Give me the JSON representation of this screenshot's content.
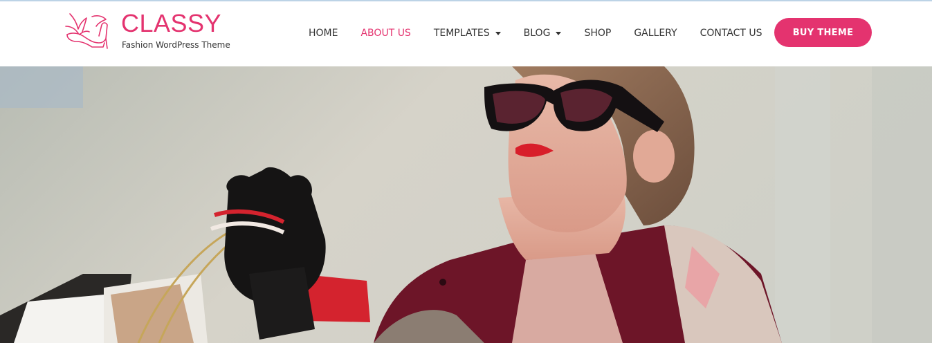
{
  "brand": {
    "title": "CLASSY",
    "tagline": "Fashion WordPress Theme",
    "accent_color": "#e4336f",
    "logo_icon": "high-heel-shoe-icon"
  },
  "nav": {
    "items": [
      {
        "label": "HOME",
        "active": false,
        "has_dropdown": false
      },
      {
        "label": "ABOUT US",
        "active": true,
        "has_dropdown": false
      },
      {
        "label": "TEMPLATES",
        "active": false,
        "has_dropdown": true
      },
      {
        "label": "BLOG",
        "active": false,
        "has_dropdown": true
      },
      {
        "label": "SHOP",
        "active": false,
        "has_dropdown": false
      },
      {
        "label": "GALLERY",
        "active": false,
        "has_dropdown": false
      },
      {
        "label": "CONTACT US",
        "active": false,
        "has_dropdown": false
      }
    ]
  },
  "cta": {
    "label": "BUY THEME"
  }
}
